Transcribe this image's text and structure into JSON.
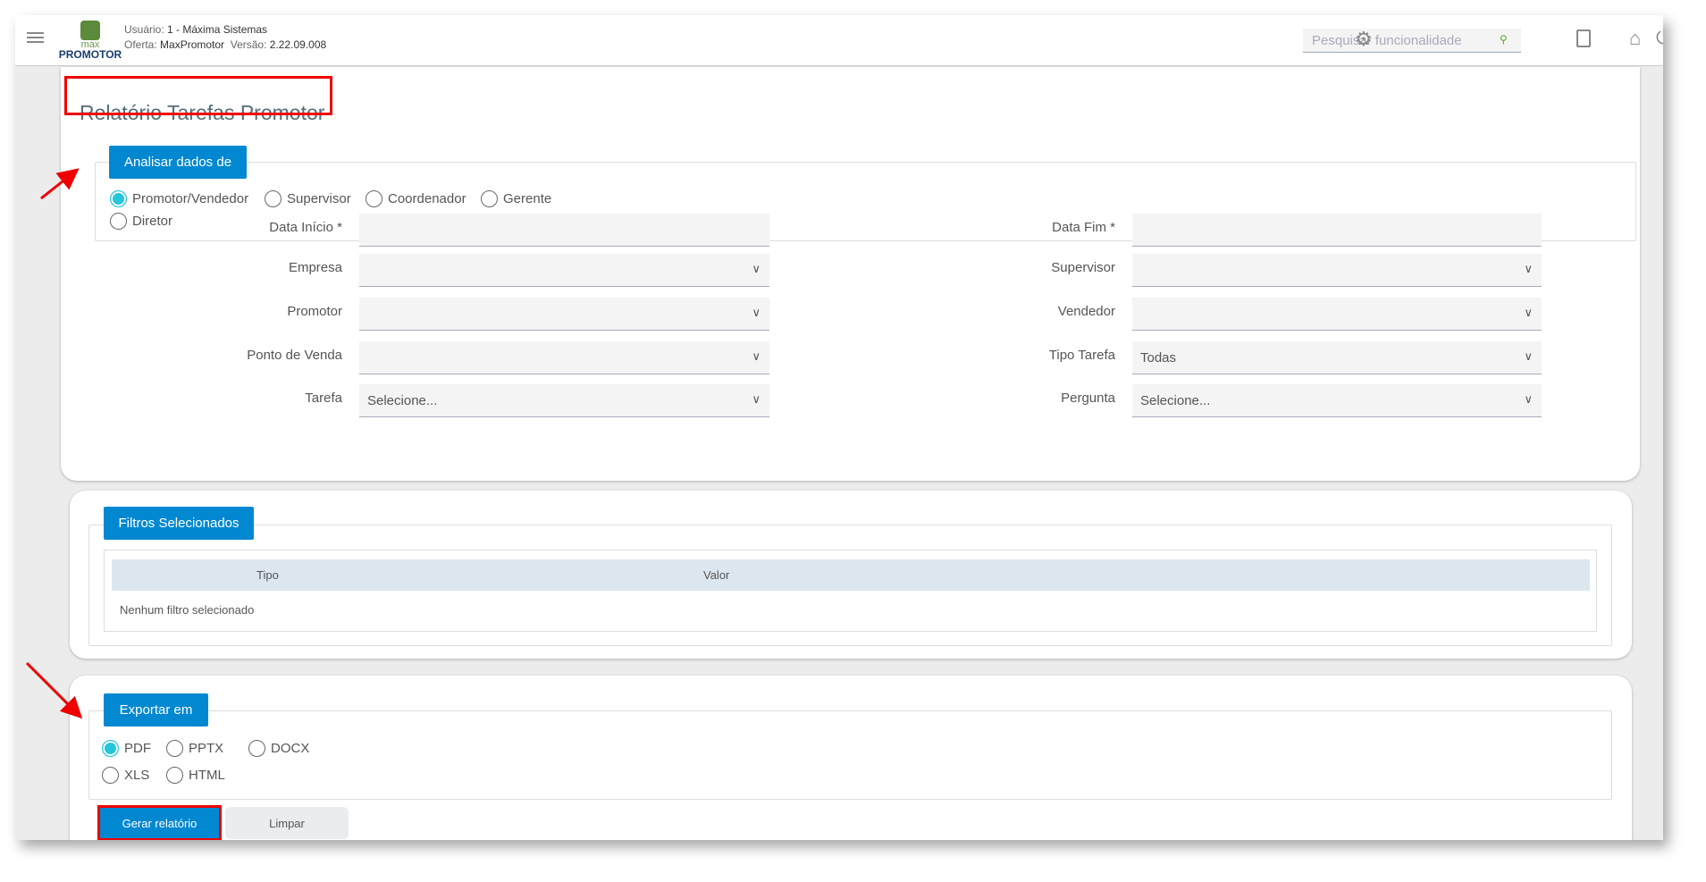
{
  "header": {
    "user_label": "Usuário:",
    "user_value": "1 - Máxima Sistemas",
    "offer_label": "Oferta:",
    "offer_value": "MaxPromotor",
    "version_label": "Versão:",
    "version_value": "2.22.09.008",
    "logo_top": "max",
    "logo_bottom": "PROMOTOR",
    "search_placeholder": "Pesquisar funcionalidade"
  },
  "page_title": "Relatório Tarefas Promotor",
  "analyze": {
    "legend": "Analisar dados de",
    "options": [
      "Promotor/Vendedor",
      "Supervisor",
      "Coordenador",
      "Gerente",
      "Diretor"
    ],
    "selected": "Promotor/Vendedor"
  },
  "form": {
    "left": [
      {
        "label": "Data Início *",
        "value": ""
      },
      {
        "label": "Empresa",
        "value": ""
      },
      {
        "label": "Promotor",
        "value": ""
      },
      {
        "label": "Ponto de Venda",
        "value": ""
      },
      {
        "label": "Tarefa",
        "value": "Selecione..."
      }
    ],
    "right": [
      {
        "label": "Data Fim *",
        "value": ""
      },
      {
        "label": "Supervisor",
        "value": ""
      },
      {
        "label": "Vendedor",
        "value": ""
      },
      {
        "label": "Tipo Tarefa",
        "value": "Todas"
      },
      {
        "label": "Pergunta",
        "value": "Selecione..."
      }
    ]
  },
  "filters": {
    "legend": "Filtros Selecionados",
    "columns": [
      "Tipo",
      "Valor"
    ],
    "empty": "Nenhum filtro selecionado"
  },
  "export": {
    "legend": "Exportar em",
    "options": [
      "PDF",
      "PPTX",
      "DOCX",
      "XLS",
      "HTML"
    ],
    "selected": "PDF",
    "generate_label": "Gerar relatório",
    "clear_label": "Limpar"
  },
  "colors": {
    "accent": "#0288d1",
    "radio": "#26c6da",
    "highlight": "#ee0000"
  }
}
